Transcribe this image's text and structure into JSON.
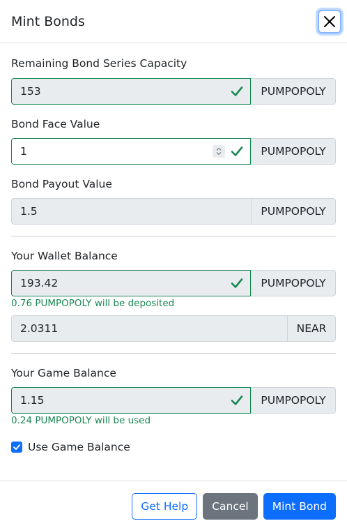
{
  "modal": {
    "title": "Mint Bonds"
  },
  "fields": {
    "remaining_capacity": {
      "label": "Remaining Bond Series Capacity",
      "value": "153",
      "unit": "PUMPOPOLY"
    },
    "face_value": {
      "label": "Bond Face Value",
      "value": "1",
      "unit": "PUMPOPOLY"
    },
    "payout_value": {
      "label": "Bond Payout Value",
      "value": "1.5",
      "unit": "PUMPOPOLY"
    },
    "wallet_balance": {
      "label": "Your Wallet Balance",
      "value": "193.42",
      "unit": "PUMPOPOLY",
      "hint": "0.76 PUMPOPOLY will be deposited"
    },
    "near_balance": {
      "value": "2.0311",
      "unit": "NEAR"
    },
    "game_balance": {
      "label": "Your Game Balance",
      "value": "1.15",
      "unit": "PUMPOPOLY",
      "hint": "0.24 PUMPOPOLY will be used"
    },
    "use_game_balance": {
      "label": "Use Game Balance",
      "checked": true
    }
  },
  "footer": {
    "help_label": "Get Help",
    "cancel_label": "Cancel",
    "mint_label": "Mint Bond"
  },
  "colors": {
    "primary": "#0d6efd",
    "success": "#198754",
    "secondary": "#6c757d",
    "readonly_bg": "#e9ecef"
  },
  "icons": {
    "close": "x-icon",
    "valid": "check-icon",
    "checkbox": "checkbox-checked-icon"
  }
}
